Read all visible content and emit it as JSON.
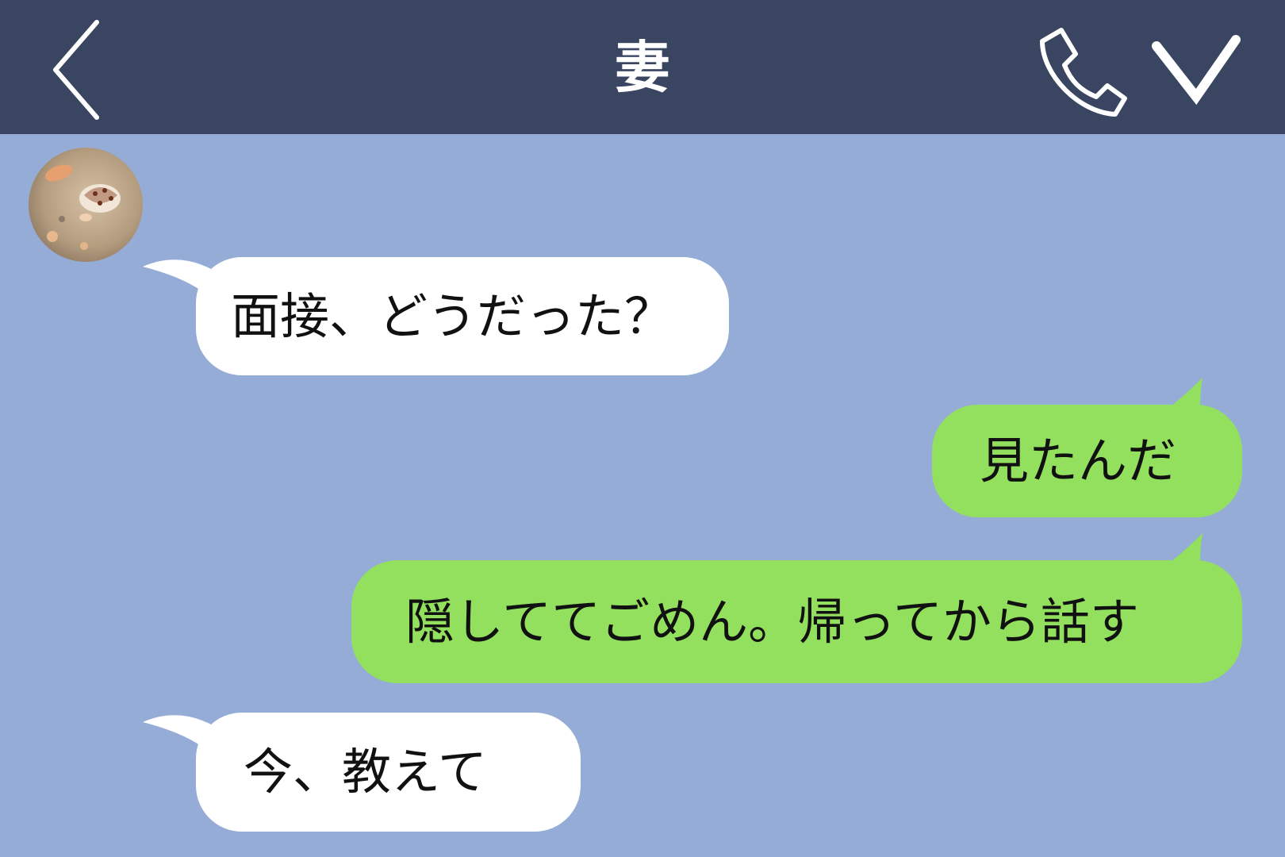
{
  "header": {
    "title": "妻"
  },
  "colors": {
    "header_bg": "#3a4561",
    "chat_bg": "#95add6",
    "incoming_bubble": "#ffffff",
    "outgoing_bubble": "#93e05f"
  },
  "icons": {
    "back": "chevron-left-icon",
    "call": "phone-icon",
    "menu": "chevron-down-icon"
  },
  "contact": {
    "avatar": "seashell-on-sand photo"
  },
  "messages": [
    {
      "direction": "incoming",
      "text": "面接、どうだった？"
    },
    {
      "direction": "outgoing",
      "text": "見たんだ"
    },
    {
      "direction": "outgoing",
      "text": "隠しててごめん。帰ってから話す"
    },
    {
      "direction": "incoming",
      "text": "今、教えて"
    }
  ]
}
